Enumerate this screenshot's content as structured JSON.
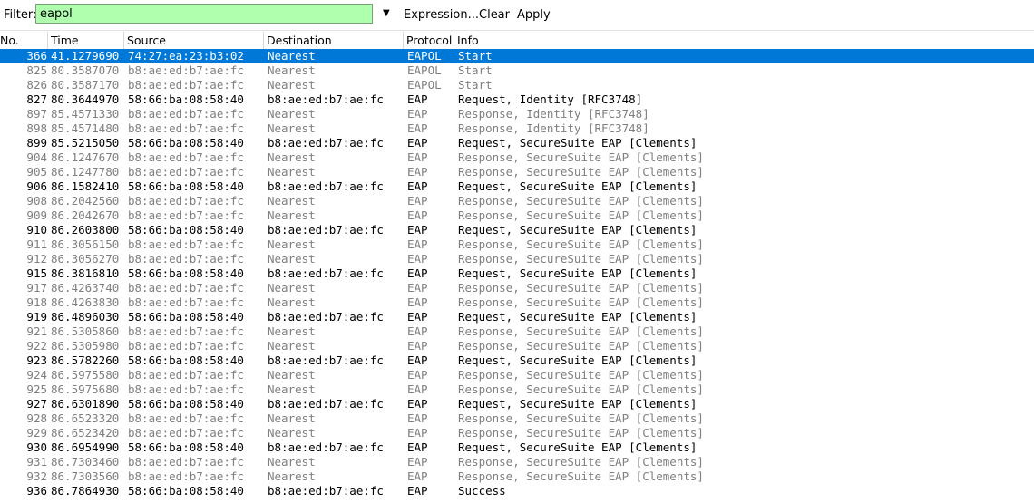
{
  "toolbar": {
    "filter_label": "Filter:",
    "filter_value": "eapol",
    "expression_label": "Expression...",
    "clear_label": "Clear",
    "apply_label": "Apply"
  },
  "columns": [
    "No.",
    "Time",
    "Source",
    "Destination",
    "Protocol",
    "Info"
  ],
  "selected_index": 0,
  "rows": [
    {
      "no": "366",
      "time": "41.1279690",
      "source": "74:27:ea:23:b3:02",
      "destination": "Nearest",
      "protocol": "EAPOL",
      "info": "Start",
      "dim": false
    },
    {
      "no": "825",
      "time": "80.3587070",
      "source": "b8:ae:ed:b7:ae:fc",
      "destination": "Nearest",
      "protocol": "EAPOL",
      "info": "Start",
      "dim": true
    },
    {
      "no": "826",
      "time": "80.3587170",
      "source": "b8:ae:ed:b7:ae:fc",
      "destination": "Nearest",
      "protocol": "EAPOL",
      "info": "Start",
      "dim": true
    },
    {
      "no": "827",
      "time": "80.3644970",
      "source": "58:66:ba:08:58:40",
      "destination": "b8:ae:ed:b7:ae:fc",
      "protocol": "EAP",
      "info": "Request, Identity [RFC3748]",
      "dim": false
    },
    {
      "no": "897",
      "time": "85.4571330",
      "source": "b8:ae:ed:b7:ae:fc",
      "destination": "Nearest",
      "protocol": "EAP",
      "info": "Response, Identity [RFC3748]",
      "dim": true
    },
    {
      "no": "898",
      "time": "85.4571480",
      "source": "b8:ae:ed:b7:ae:fc",
      "destination": "Nearest",
      "protocol": "EAP",
      "info": "Response, Identity [RFC3748]",
      "dim": true
    },
    {
      "no": "899",
      "time": "85.5215050",
      "source": "58:66:ba:08:58:40",
      "destination": "b8:ae:ed:b7:ae:fc",
      "protocol": "EAP",
      "info": "Request, SecureSuite EAP [Clements]",
      "dim": false
    },
    {
      "no": "904",
      "time": "86.1247670",
      "source": "b8:ae:ed:b7:ae:fc",
      "destination": "Nearest",
      "protocol": "EAP",
      "info": "Response, SecureSuite EAP [Clements]",
      "dim": true
    },
    {
      "no": "905",
      "time": "86.1247780",
      "source": "b8:ae:ed:b7:ae:fc",
      "destination": "Nearest",
      "protocol": "EAP",
      "info": "Response, SecureSuite EAP [Clements]",
      "dim": true
    },
    {
      "no": "906",
      "time": "86.1582410",
      "source": "58:66:ba:08:58:40",
      "destination": "b8:ae:ed:b7:ae:fc",
      "protocol": "EAP",
      "info": "Request, SecureSuite EAP [Clements]",
      "dim": false
    },
    {
      "no": "908",
      "time": "86.2042560",
      "source": "b8:ae:ed:b7:ae:fc",
      "destination": "Nearest",
      "protocol": "EAP",
      "info": "Response, SecureSuite EAP [Clements]",
      "dim": true
    },
    {
      "no": "909",
      "time": "86.2042670",
      "source": "b8:ae:ed:b7:ae:fc",
      "destination": "Nearest",
      "protocol": "EAP",
      "info": "Response, SecureSuite EAP [Clements]",
      "dim": true
    },
    {
      "no": "910",
      "time": "86.2603800",
      "source": "58:66:ba:08:58:40",
      "destination": "b8:ae:ed:b7:ae:fc",
      "protocol": "EAP",
      "info": "Request, SecureSuite EAP [Clements]",
      "dim": false
    },
    {
      "no": "911",
      "time": "86.3056150",
      "source": "b8:ae:ed:b7:ae:fc",
      "destination": "Nearest",
      "protocol": "EAP",
      "info": "Response, SecureSuite EAP [Clements]",
      "dim": true
    },
    {
      "no": "912",
      "time": "86.3056270",
      "source": "b8:ae:ed:b7:ae:fc",
      "destination": "Nearest",
      "protocol": "EAP",
      "info": "Response, SecureSuite EAP [Clements]",
      "dim": true
    },
    {
      "no": "915",
      "time": "86.3816810",
      "source": "58:66:ba:08:58:40",
      "destination": "b8:ae:ed:b7:ae:fc",
      "protocol": "EAP",
      "info": "Request, SecureSuite EAP [Clements]",
      "dim": false
    },
    {
      "no": "917",
      "time": "86.4263740",
      "source": "b8:ae:ed:b7:ae:fc",
      "destination": "Nearest",
      "protocol": "EAP",
      "info": "Response, SecureSuite EAP [Clements]",
      "dim": true
    },
    {
      "no": "918",
      "time": "86.4263830",
      "source": "b8:ae:ed:b7:ae:fc",
      "destination": "Nearest",
      "protocol": "EAP",
      "info": "Response, SecureSuite EAP [Clements]",
      "dim": true
    },
    {
      "no": "919",
      "time": "86.4896030",
      "source": "58:66:ba:08:58:40",
      "destination": "b8:ae:ed:b7:ae:fc",
      "protocol": "EAP",
      "info": "Request, SecureSuite EAP [Clements]",
      "dim": false
    },
    {
      "no": "921",
      "time": "86.5305860",
      "source": "b8:ae:ed:b7:ae:fc",
      "destination": "Nearest",
      "protocol": "EAP",
      "info": "Response, SecureSuite EAP [Clements]",
      "dim": true
    },
    {
      "no": "922",
      "time": "86.5305980",
      "source": "b8:ae:ed:b7:ae:fc",
      "destination": "Nearest",
      "protocol": "EAP",
      "info": "Response, SecureSuite EAP [Clements]",
      "dim": true
    },
    {
      "no": "923",
      "time": "86.5782260",
      "source": "58:66:ba:08:58:40",
      "destination": "b8:ae:ed:b7:ae:fc",
      "protocol": "EAP",
      "info": "Request, SecureSuite EAP [Clements]",
      "dim": false
    },
    {
      "no": "924",
      "time": "86.5975580",
      "source": "b8:ae:ed:b7:ae:fc",
      "destination": "Nearest",
      "protocol": "EAP",
      "info": "Response, SecureSuite EAP [Clements]",
      "dim": true
    },
    {
      "no": "925",
      "time": "86.5975680",
      "source": "b8:ae:ed:b7:ae:fc",
      "destination": "Nearest",
      "protocol": "EAP",
      "info": "Response, SecureSuite EAP [Clements]",
      "dim": true
    },
    {
      "no": "927",
      "time": "86.6301890",
      "source": "58:66:ba:08:58:40",
      "destination": "b8:ae:ed:b7:ae:fc",
      "protocol": "EAP",
      "info": "Request, SecureSuite EAP [Clements]",
      "dim": false
    },
    {
      "no": "928",
      "time": "86.6523320",
      "source": "b8:ae:ed:b7:ae:fc",
      "destination": "Nearest",
      "protocol": "EAP",
      "info": "Response, SecureSuite EAP [Clements]",
      "dim": true
    },
    {
      "no": "929",
      "time": "86.6523420",
      "source": "b8:ae:ed:b7:ae:fc",
      "destination": "Nearest",
      "protocol": "EAP",
      "info": "Response, SecureSuite EAP [Clements]",
      "dim": true
    },
    {
      "no": "930",
      "time": "86.6954990",
      "source": "58:66:ba:08:58:40",
      "destination": "b8:ae:ed:b7:ae:fc",
      "protocol": "EAP",
      "info": "Request, SecureSuite EAP [Clements]",
      "dim": false
    },
    {
      "no": "931",
      "time": "86.7303460",
      "source": "b8:ae:ed:b7:ae:fc",
      "destination": "Nearest",
      "protocol": "EAP",
      "info": "Response, SecureSuite EAP [Clements]",
      "dim": true
    },
    {
      "no": "932",
      "time": "86.7303560",
      "source": "b8:ae:ed:b7:ae:fc",
      "destination": "Nearest",
      "protocol": "EAP",
      "info": "Response, SecureSuite EAP [Clements]",
      "dim": true
    },
    {
      "no": "936",
      "time": "86.7864930",
      "source": "58:66:ba:08:58:40",
      "destination": "b8:ae:ed:b7:ae:fc",
      "protocol": "EAP",
      "info": "Success",
      "dim": false
    }
  ],
  "colors": {
    "filter_bg": "#afffaf",
    "selection_bg": "#0078d7",
    "dim_text": "#7f7f7f"
  }
}
